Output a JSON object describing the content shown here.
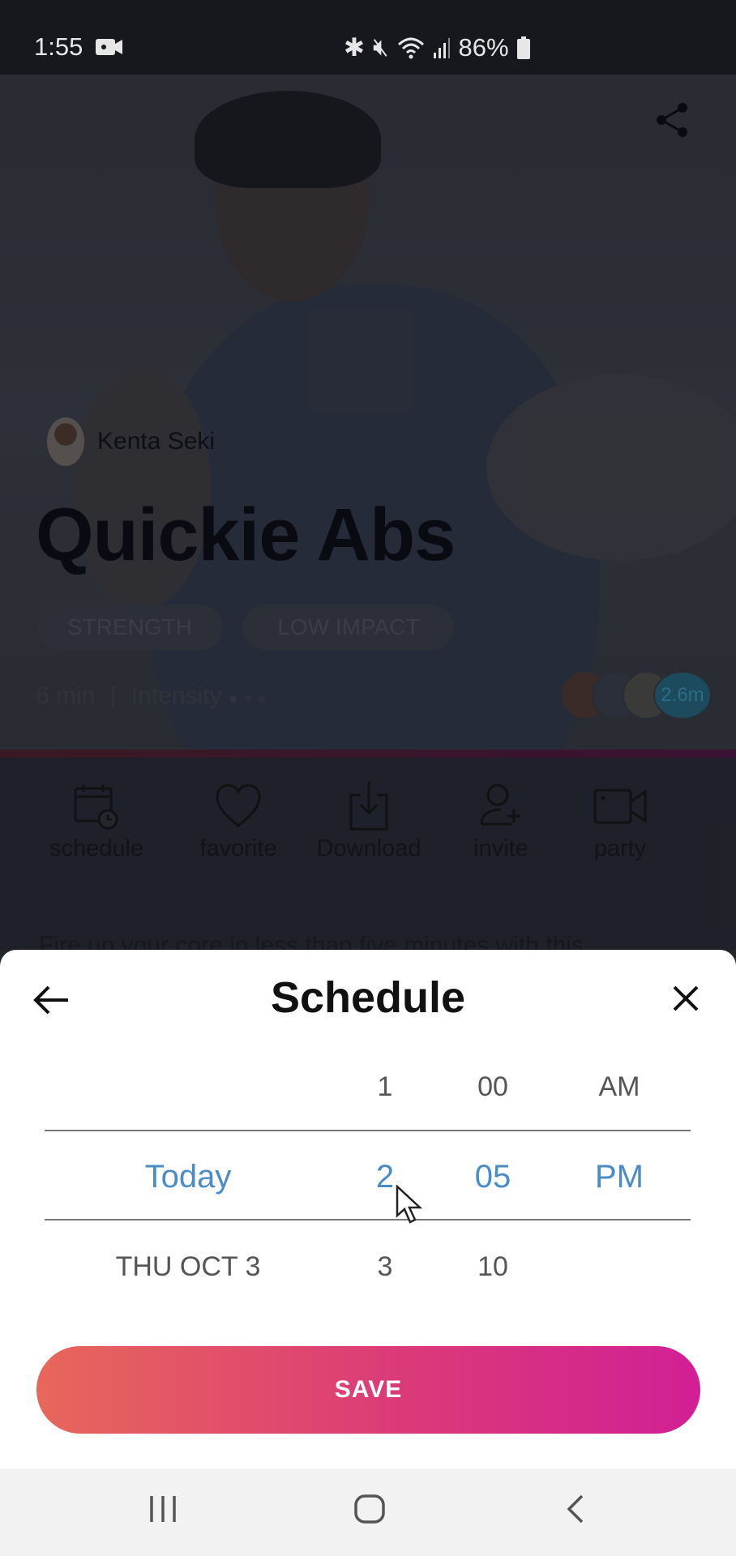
{
  "status_bar": {
    "time": "1:55",
    "battery": "86%",
    "icons": [
      "video-record-icon",
      "bluetooth-icon",
      "vibrate-mute-icon",
      "wifi-icon",
      "signal-icon",
      "battery-icon"
    ]
  },
  "workout": {
    "instructor": "Kenta Seki",
    "title": "Quickie Abs",
    "tags": [
      "STRENGTH",
      "LOW IMPACT"
    ],
    "duration": "6 min",
    "intensity_label": "Intensity",
    "intensity_level": 1,
    "intensity_max": 3,
    "participants_count": "2.6m",
    "description": "Fire up your core in less than five minutes with this"
  },
  "actions": [
    {
      "label": "schedule",
      "icon": "calendar-clock-icon"
    },
    {
      "label": "favorite",
      "icon": "heart-icon"
    },
    {
      "label": "Download",
      "icon": "download-icon"
    },
    {
      "label": "invite",
      "icon": "add-user-icon"
    },
    {
      "label": "party",
      "icon": "video-camera-icon"
    }
  ],
  "sheet": {
    "title": "Schedule",
    "save_label": "SAVE",
    "picker": {
      "rows": [
        {
          "date": "",
          "hour": "1",
          "minute": "00",
          "ampm": "AM"
        },
        {
          "date": "Today",
          "hour": "2",
          "minute": "05",
          "ampm": "PM"
        },
        {
          "date": "THU OCT 3",
          "hour": "3",
          "minute": "10",
          "ampm": ""
        }
      ],
      "selected_index": 1
    }
  },
  "colors": {
    "accent_blue": "#4a8cc9",
    "save_gradient_start": "#e8675a",
    "save_gradient_end": "#d21f95"
  }
}
